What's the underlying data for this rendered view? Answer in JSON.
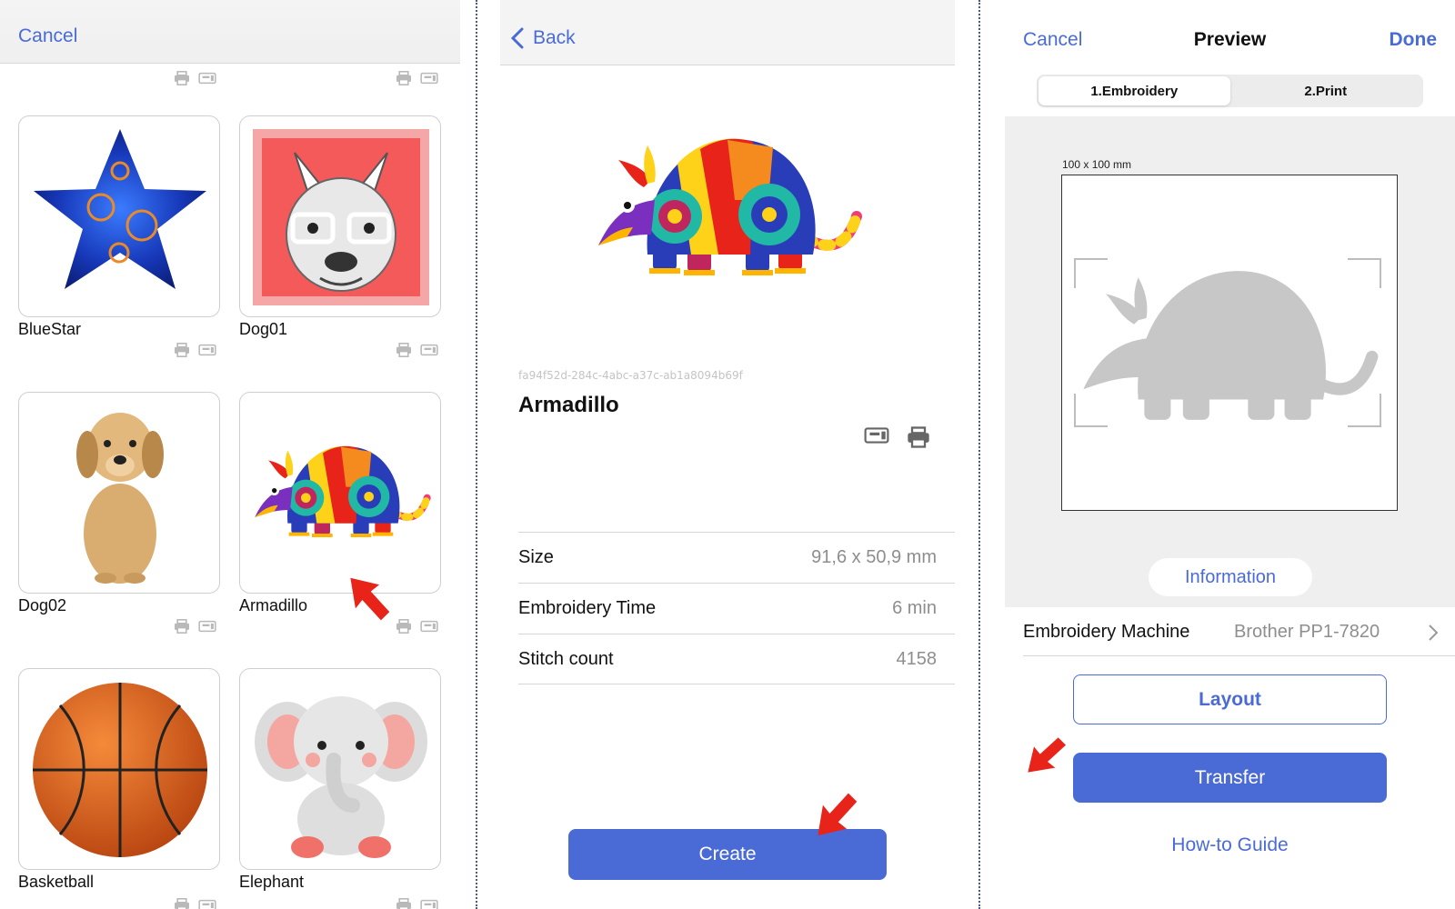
{
  "colors": {
    "accent": "#4a6bd6",
    "annotation_arrow": "#e8231a",
    "secondary_text": "#8e8e8e"
  },
  "panel1": {
    "cancel_label": "Cancel",
    "designs": [
      {
        "name": "BlueStar",
        "icon": "blue-star-image"
      },
      {
        "name": "Dog01",
        "icon": "french-bulldog-glasses-image"
      },
      {
        "name": "Dog02",
        "icon": "puppy-image"
      },
      {
        "name": "Armadillo",
        "icon": "armadillo-image"
      },
      {
        "name": "Basketball",
        "icon": "basketball-image"
      },
      {
        "name": "Elephant",
        "icon": "elephant-image"
      }
    ]
  },
  "panel2": {
    "back_label": "Back",
    "design_id": "fa94f52d-284c-4abc-a37c-ab1a8094b69f",
    "design_title": "Armadillo",
    "specs": [
      {
        "label": "Size",
        "value": "91,6 x 50,9 mm"
      },
      {
        "label": "Embroidery Time",
        "value": "6 min"
      },
      {
        "label": "Stitch count",
        "value": "4158"
      }
    ],
    "create_label": "Create"
  },
  "panel3": {
    "cancel_label": "Cancel",
    "title": "Preview",
    "done_label": "Done",
    "tabs": [
      {
        "label": "1.Embroidery",
        "active": true
      },
      {
        "label": "2.Print",
        "active": false
      }
    ],
    "hoop_size": "100 x 100 mm",
    "information_label": "Information",
    "machine_label": "Embroidery Machine",
    "machine_value": "Brother PP1-7820",
    "layout_label": "Layout",
    "transfer_label": "Transfer",
    "howto_label": "How-to Guide"
  }
}
